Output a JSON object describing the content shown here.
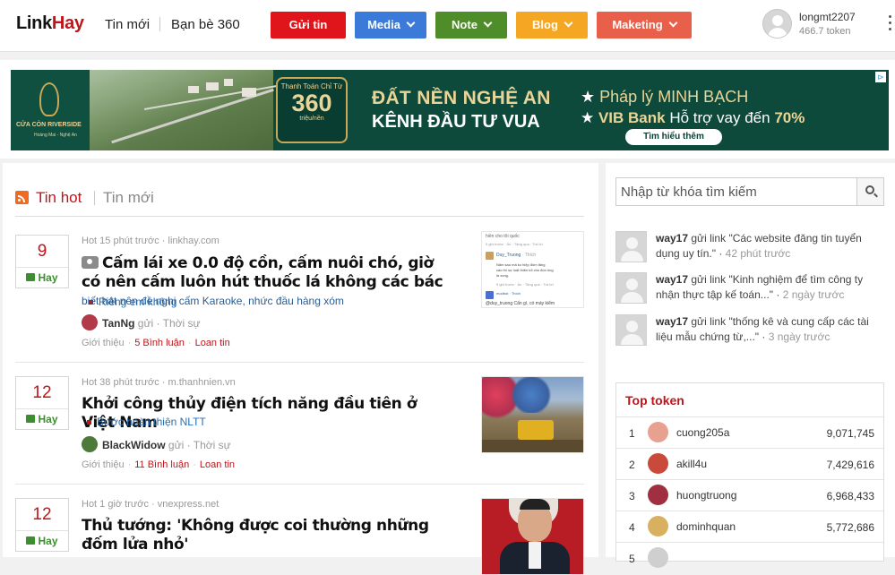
{
  "header": {
    "logo_left": "Link",
    "logo_right": "Hay",
    "nav": [
      "Tin mới",
      "Bạn bè 360"
    ],
    "buttons": [
      {
        "label": "Gửi tin",
        "color": "#e0141b",
        "dropdown": false
      },
      {
        "label": "Media",
        "color": "#3b7ad9",
        "dropdown": true
      },
      {
        "label": "Note",
        "color": "#4f8c2a",
        "dropdown": true
      },
      {
        "label": "Blog",
        "color": "#f5a623",
        "dropdown": true
      },
      {
        "label": "Maketing",
        "color": "#e8604a",
        "dropdown": true
      }
    ],
    "user": {
      "name": "longmt2207",
      "token": "466.7 token"
    }
  },
  "banner": {
    "logo_title": "CỬA CÒN RIVERSIDE",
    "logo_sub": "Hoàng Mai - Nghệ An",
    "badge_top": "Thanh Toán Chỉ Từ",
    "badge_num": "360",
    "badge_unit": "triệu/nền",
    "headline1": "ĐẤT NỀN NGHỆ AN",
    "headline2": "KÊNH ĐẦU TƯ VUA",
    "point1_pre": "Pháp lý ",
    "point1_strong": "MINH BẠCH",
    "point2_pre": "VIB Bank ",
    "point2_rest": "Hỗ trợ vay đến ",
    "point2_pct": "70%",
    "cta": "Tìm hiểu thêm"
  },
  "tabs": {
    "hot": "Tin hot",
    "new": "Tin mới"
  },
  "posts": [
    {
      "votes": "9",
      "hay": "Hay",
      "meta": "Hot 15 phút trước",
      "domain": "linkhay.com",
      "title": "Cấm lái xe 0.0 độ cồn, cấm nuôi chó, giờ có nên cấm luôn hút thuốc lá không các bác",
      "has_camera": true,
      "category": "Riêng em không",
      "desc": "biết hát nên đề nghị cấm Karaoke, nhức đầu hàng xóm",
      "poster": "TanNg",
      "action_word": "gửi",
      "section": "Thời sự",
      "intro": "Giới thiệu",
      "comments": "5 Bình luận",
      "share": "Loan tin",
      "avatar_color": "#b23a48"
    },
    {
      "votes": "12",
      "hay": "Hay",
      "meta": "Hot 38 phút trước",
      "domain": "m.thanhnien.vn",
      "title": "Khởi công thủy điện tích năng đầu tiên ở Việt Nam",
      "has_camera": false,
      "category": "Bước hoàn thiện NLTT",
      "desc": "",
      "poster": "BlackWidow",
      "action_word": "gửi",
      "section": "Thời sự",
      "intro": "Giới thiệu",
      "comments": "11 Bình luận",
      "share": "Loan tin",
      "avatar_color": "#4c7a3a"
    },
    {
      "votes": "12",
      "hay": "Hay",
      "meta": "Hot 1 giờ trước",
      "domain": "vnexpress.net",
      "title": "Thủ tướng: 'Không được coi thường những đốm lửa nhỏ'",
      "has_camera": false,
      "category": "",
      "desc": "",
      "poster": "",
      "action_word": "",
      "section": "",
      "intro": "",
      "comments": "",
      "share": "",
      "avatar_color": "#888888"
    }
  ],
  "thumb1": {
    "line1": "hiền cho tôi quốc",
    "line2": "5 giờ trước · Ẩn · Tặng quà · Trả lời",
    "author": "Duy_Truong",
    "action": "· Thích",
    "body1": "Năm sau mà ko hiệp đồm tăng",
    "body2": "cao thì sự luật thiên tối cho đón ông",
    "body3": "là xong.",
    "line3": "5 giờ trước · Ẩn · Tặng quà · Trả lời",
    "line4": "modbot · Thích",
    "line5": "@duy_truong Cẩn gì, có máy kiểm"
  },
  "sidebar": {
    "search_placeholder": "Nhập từ khóa tìm kiếm",
    "activity": [
      {
        "user": "way17",
        "verb": "gửi link",
        "text": "\"Các website đăng tin tuyển dụng uy tín.\"",
        "ago": "42 phút trước"
      },
      {
        "user": "way17",
        "verb": "gửi link",
        "text": "\"Kinh nghiệm để tìm công ty nhận thực tập kế toán...\"",
        "ago": "2 ngày trước"
      },
      {
        "user": "way17",
        "verb": "gửi link",
        "text": "\"thống kê và cung cấp các tài liệu mẫu chứng từ,...\"",
        "ago": "3 ngày trước"
      }
    ],
    "top_token": {
      "title": "Top token",
      "rows": [
        {
          "rank": "1",
          "name": "cuong205a",
          "score": "9,071,745",
          "color": "#e8a090"
        },
        {
          "rank": "2",
          "name": "akill4u",
          "score": "7,429,616",
          "color": "#c94a3a"
        },
        {
          "rank": "3",
          "name": "huongtruong",
          "score": "6,968,433",
          "color": "#a03040"
        },
        {
          "rank": "4",
          "name": "dominhquan",
          "score": "5,772,686",
          "color": "#d9b060"
        },
        {
          "rank": "5",
          "name": "",
          "score": "",
          "color": "#cfcfcf"
        }
      ]
    }
  }
}
